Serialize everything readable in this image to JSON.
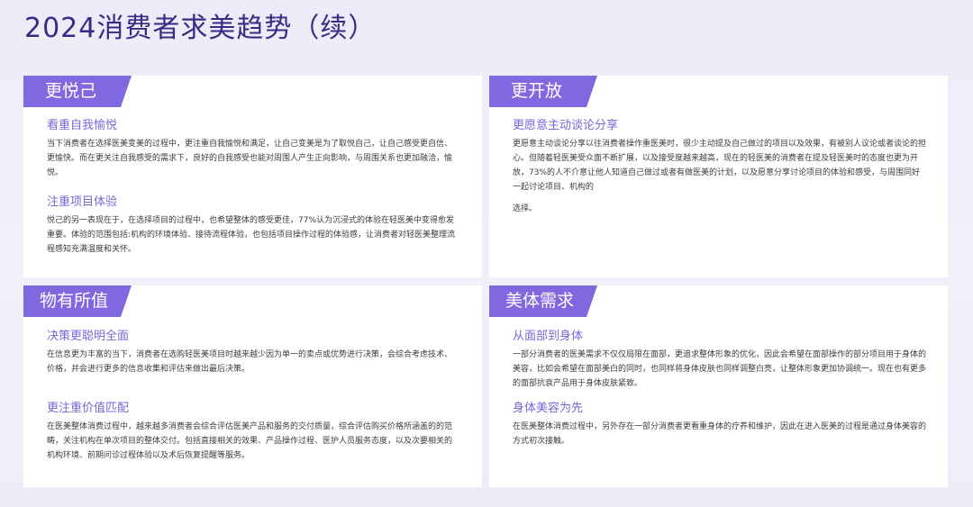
{
  "page": {
    "title": "2024消费者求美趋势（续）"
  },
  "colors": {
    "title": "#3a2a86",
    "tag_bg": "#8068e0",
    "subtitle": "#7a64d8",
    "body_text": "#3c3c3c",
    "card_bg": "#ffffff"
  },
  "cards": [
    {
      "tag": "更悦己",
      "sections": [
        {
          "subtitle": "看重自我愉悦",
          "text": "当下消费者在选择医美变美的过程中，更注重自我愉悦和满足，让自己变美是为了取悦自己，让自己感受更自信、更愉快。而在更关注自我感受的需求下，良好的自我感受也能对周围人产生正向影响，与周围关系也更加融洽，愉悦。"
        },
        {
          "subtitle": "注重项目体验",
          "text": "悦己的另一表现在于，在选择项目的过程中，也希望整体的感受更佳，77%认为沉浸式的体验在轻医美中变得愈发重要。体验的范围包括:机构的环境体验、接待流程体验，也包括项目操作过程的体验感，让消费者对轻医美整理流程感知充满温度和关怀。"
        }
      ]
    },
    {
      "tag": "更开放",
      "sections": [
        {
          "subtitle": "更愿意主动谈论分享",
          "text": "更愿意主动谈论分享以往消费者操作重医美时，很少主动提及自己做过的项目以及效果，有被别人议论或者谈论的担心。但随着轻医美受众面不断扩展，以及接受度越来越高，现在的轻医美的消费者在提及轻医美时的态度也更为开放，73%的人不介意让他人知道自己做过或者有做医美的计划，以及愿意分享讨论项目的体验和感受，与周围同好一起讨论项目、机构的",
          "text2": "选择。"
        }
      ]
    },
    {
      "tag": "物有所值",
      "sections": [
        {
          "subtitle": "决策更聪明全面",
          "text": "在信息更为丰富的当下，消费者在选购轻医美项目时越来越少因为单一的卖点或优势进行决策，会综合考虑技术、价格，并会进行更多的信息收集和评估来做出最后决策。"
        },
        {
          "subtitle": "更注重价值匹配",
          "text": "在医美整体消费过程中，越来越多消费者会综合评估医美产品和服务的交付质量，综合评估购买价格所涵盖的的范畴，关注机构在单次项目的整体交付。包括直接相关的效果、产品操作过程、医护人员服务态度，以及次要相关的机构环境、前期问诊过程体验以及术后恢复提醒等服务。"
        }
      ]
    },
    {
      "tag": "美体需求",
      "sections": [
        {
          "subtitle": "从面部到身体",
          "text": "一部分消费者的医美需求不仅仅局限在面部，更追求整体形象的优化，因此会希望在面部操作的部分项目用于身体的美容，比如会希望在面部美白的同时，也同样将身体皮肤也同样调整白亮，让整体形象更加协调统一。现在也有更多的面部抗衰产品用于身体皮肤紧致。"
        },
        {
          "subtitle": "身体美容为先",
          "text": "在医美整体消费过程中，另外存在一部分消费者更看重身体的疗养和维护，因此在进入医美的过程是通过身体美容的方式初次接触。"
        }
      ]
    }
  ]
}
